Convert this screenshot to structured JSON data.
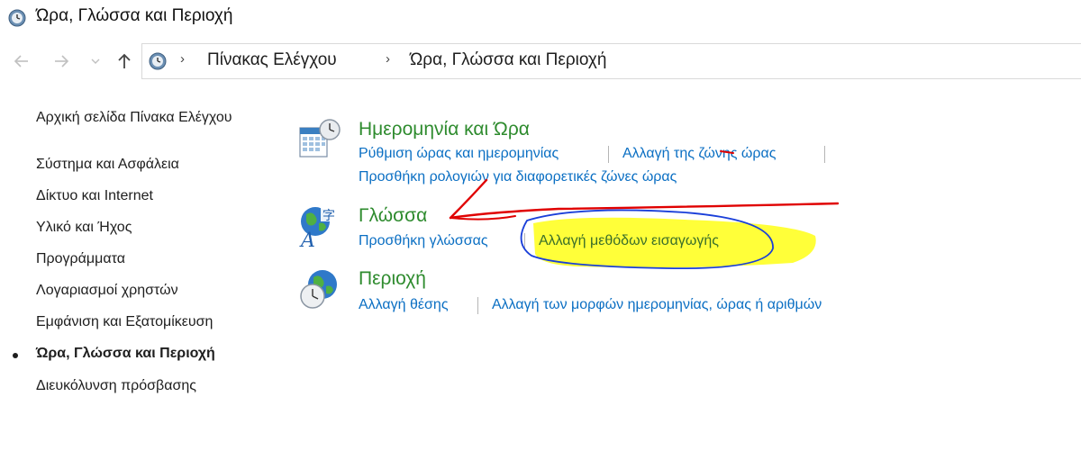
{
  "window": {
    "title": "Ώρα, Γλώσσα και Περιοχή"
  },
  "nav": {
    "back_icon": "arrow-left-icon",
    "forward_icon": "arrow-right-icon",
    "recent_icon": "chevron-down-icon",
    "up_icon": "arrow-up-icon"
  },
  "breadcrumb": {
    "items": [
      "Πίνακας Ελέγχου",
      "Ώρα, Γλώσσα και Περιοχή"
    ],
    "separator": "›"
  },
  "sidebar": {
    "items": [
      {
        "label": "Αρχική σελίδα Πίνακα Ελέγχου"
      },
      {
        "label": "Σύστημα και Ασφάλεια"
      },
      {
        "label": "Δίκτυο και Internet"
      },
      {
        "label": "Υλικό και Ήχος"
      },
      {
        "label": "Προγράμματα"
      },
      {
        "label": "Λογαριασμοί χρηστών"
      },
      {
        "label": "Εμφάνιση και Εξατομίκευση"
      },
      {
        "label": "Ώρα, Γλώσσα και Περιοχή",
        "current": true
      },
      {
        "label": "Διευκόλυνση πρόσβασης"
      }
    ]
  },
  "categories": [
    {
      "title": "Ημερομηνία και Ώρα",
      "icon": "calendar-clock-icon",
      "links": [
        "Ρύθμιση ώρας και ημερομηνίας",
        "Αλλαγή της ζώνης ώρας",
        "Προσθήκη ρολογιών για διαφορετικές ζώνες ώρας"
      ]
    },
    {
      "title": "Γλώσσα",
      "icon": "globe-language-icon",
      "links": [
        "Προσθήκη γλώσσας",
        "Αλλαγή μεθόδων εισαγωγής"
      ]
    },
    {
      "title": "Περιοχή",
      "icon": "globe-clock-icon",
      "links": [
        "Αλλαγή θέσης",
        "Αλλαγή των μορφών ημερομηνίας, ώρας ή αριθμών"
      ]
    }
  ],
  "colors": {
    "link": "#0b6fc3",
    "category_title": "#2e8b2e",
    "highlight": "#ffff33",
    "annotation_red": "#e00000",
    "annotation_blue": "#1a3fd9"
  }
}
